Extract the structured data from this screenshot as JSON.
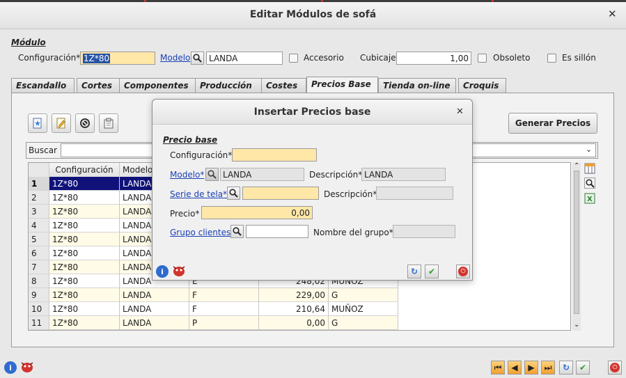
{
  "window": {
    "title": "Editar Módulos de sofá"
  },
  "header": {
    "section": "Módulo",
    "configuracion_label": "Configuración*",
    "configuracion_value": "1Z*80",
    "modelo_link": "Modelo",
    "modelo_value": "LANDA",
    "accesorio_label": "Accesorio",
    "cubicaje_label": "Cubicaje",
    "cubicaje_value": "1,00",
    "obsoleto_label": "Obsoleto",
    "es_sillon_label": "Es sillón"
  },
  "tabs": [
    {
      "label": "Escandallo"
    },
    {
      "label": "Cortes"
    },
    {
      "label": "Componentes"
    },
    {
      "label": "Producción"
    },
    {
      "label": "Costes"
    },
    {
      "label": "Precios Base"
    },
    {
      "label": "Tienda on-line"
    },
    {
      "label": "Croquis"
    }
  ],
  "panel": {
    "generar_label": "Generar Precios",
    "buscar_label": "Buscar",
    "buscar_value": ""
  },
  "table": {
    "columns": [
      "Configuración",
      "Modelo"
    ],
    "rows": [
      {
        "n": "1",
        "config": "1Z*80",
        "modelo": "LANDA",
        "serie": "",
        "precio": "",
        "grupo": ""
      },
      {
        "n": "2",
        "config": "1Z*80",
        "modelo": "LANDA",
        "serie": "",
        "precio": "",
        "grupo": ""
      },
      {
        "n": "3",
        "config": "1Z*80",
        "modelo": "LANDA",
        "serie": "",
        "precio": "",
        "grupo": ""
      },
      {
        "n": "4",
        "config": "1Z*80",
        "modelo": "LANDA",
        "serie": "",
        "precio": "",
        "grupo": ""
      },
      {
        "n": "5",
        "config": "1Z*80",
        "modelo": "LANDA",
        "serie": "",
        "precio": "",
        "grupo": ""
      },
      {
        "n": "6",
        "config": "1Z*80",
        "modelo": "LANDA",
        "serie": "",
        "precio": "",
        "grupo": ""
      },
      {
        "n": "7",
        "config": "1Z*80",
        "modelo": "LANDA",
        "serie": "",
        "precio": "",
        "grupo": ""
      },
      {
        "n": "8",
        "config": "1Z*80",
        "modelo": "LANDA",
        "serie": "E",
        "precio": "248,02",
        "grupo": "MUÑOZ"
      },
      {
        "n": "9",
        "config": "1Z*80",
        "modelo": "LANDA",
        "serie": "F",
        "precio": "229,00",
        "grupo": "G"
      },
      {
        "n": "10",
        "config": "1Z*80",
        "modelo": "LANDA",
        "serie": "F",
        "precio": "210,64",
        "grupo": "MUÑOZ"
      },
      {
        "n": "11",
        "config": "1Z*80",
        "modelo": "LANDA",
        "serie": "P",
        "precio": "0,00",
        "grupo": "G"
      }
    ]
  },
  "dialog": {
    "title": "Insertar Precios base",
    "section": "Precio base",
    "configuracion_label": "Configuración*",
    "configuracion_value": "",
    "modelo_link": "Modelo*",
    "modelo_value": "LANDA",
    "descripcion_label": "Descripción*",
    "descripcion_value": "LANDA",
    "serie_link": "Serie de tela*",
    "serie_value": "",
    "serie_descripcion_label": "Descripción*",
    "serie_descripcion_value": "",
    "precio_label": "Precio*",
    "precio_value": "0,00",
    "grupo_link": "Grupo clientes",
    "grupo_value": "",
    "nombre_grupo_label": "Nombre del grupo*",
    "nombre_grupo_value": ""
  },
  "icons": {
    "info": "info-icon",
    "bug": "bug-icon",
    "refresh": "refresh-icon",
    "accept": "check-icon",
    "cancel": "power-off-icon",
    "first": "first-record-icon",
    "prev": "prev-record-icon",
    "next": "next-record-icon",
    "last": "last-record-icon"
  },
  "colors": {
    "required_field": "#ffe7a8",
    "selection": "#10127a",
    "link": "#1a3fb5",
    "accent_orange": "#f0a030",
    "cancel_red": "#d0342c"
  }
}
